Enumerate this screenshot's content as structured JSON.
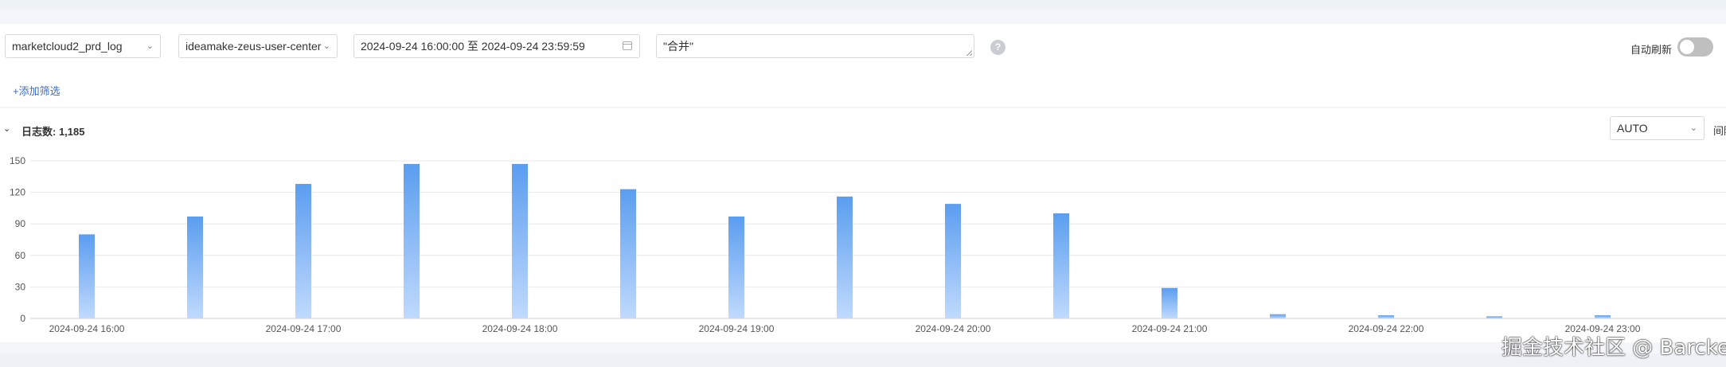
{
  "filters": {
    "logstore": "marketcloud2_prd_log",
    "service": "ideamake-zeus-user-center",
    "date_range": "2024-09-24 16:00:00 至 2024-09-24 23:59:59",
    "query": "\"合并\"",
    "help": "?",
    "auto_refresh_label": "自动刷新",
    "auto_refresh_on": false
  },
  "add_filter_label": "+添加筛选",
  "panel": {
    "log_count_label": "日志数: 1,185",
    "interval_value": "AUTO",
    "interval_extra": "间隔"
  },
  "watermark": "掘金技术社区 @ Barcke",
  "colors": {
    "bar_top": "#5b9df0",
    "bar_bottom": "#c0dafc",
    "accent": "#3b6dc4"
  },
  "chart_data": {
    "type": "bar",
    "x_tick_labels": [
      "2024-09-24 16:00",
      "2024-09-24 17:00",
      "2024-09-24 18:00",
      "2024-09-24 19:00",
      "2024-09-24 20:00",
      "2024-09-24 21:00",
      "2024-09-24 22:00",
      "2024-09-24 23:00"
    ],
    "y_ticks": [
      0,
      30,
      60,
      90,
      120,
      150
    ],
    "ylim": [
      0,
      150
    ],
    "grid": true,
    "bars": [
      {
        "x": "2024-09-24 16:00",
        "y": 80
      },
      {
        "x": "2024-09-24 16:30",
        "y": 97
      },
      {
        "x": "2024-09-24 17:00",
        "y": 128
      },
      {
        "x": "2024-09-24 17:30",
        "y": 147
      },
      {
        "x": "2024-09-24 18:00",
        "y": 147
      },
      {
        "x": "2024-09-24 18:30",
        "y": 123
      },
      {
        "x": "2024-09-24 19:00",
        "y": 97
      },
      {
        "x": "2024-09-24 19:30",
        "y": 116
      },
      {
        "x": "2024-09-24 20:00",
        "y": 109
      },
      {
        "x": "2024-09-24 20:30",
        "y": 100
      },
      {
        "x": "2024-09-24 21:00",
        "y": 29
      },
      {
        "x": "2024-09-24 21:30",
        "y": 4
      },
      {
        "x": "2024-09-24 22:00",
        "y": 3
      },
      {
        "x": "2024-09-24 22:30",
        "y": 2
      },
      {
        "x": "2024-09-24 23:00",
        "y": 3
      }
    ]
  }
}
